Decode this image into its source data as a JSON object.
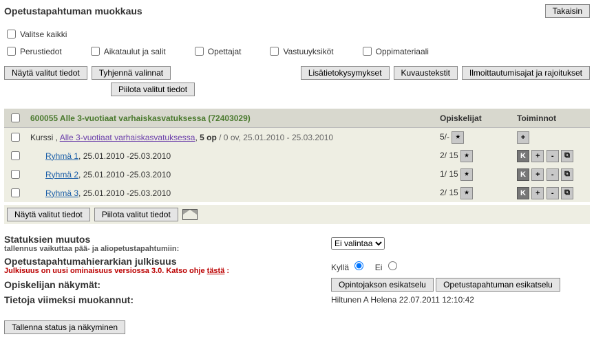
{
  "header": {
    "title": "Opetustapahtuman muokkaus",
    "back": "Takaisin"
  },
  "filters": {
    "select_all": "Valitse kaikki",
    "perustiedot": "Perustiedot",
    "aikataulut": "Aikataulut ja salit",
    "opettajat": "Opettajat",
    "vastuuyksikot": "Vastuuyksiköt",
    "oppimateriaali": "Oppimateriaali"
  },
  "buttons": {
    "nayta": "Näytä valitut tiedot",
    "tyhjenna": "Tyhjennä valinnat",
    "piilota": "Piilota valitut tiedot",
    "lisakysymykset": "Lisätietokysymykset",
    "kuvaustekstit": "Kuvaustekstit",
    "ilmoittautumisajat": "Ilmoittautumisajat ja rajoitukset"
  },
  "table": {
    "head_course": "600055 Alle 3-vuotiaat varhaiskasvatuksessa (72403029)",
    "head_students": "Opiskelijat",
    "head_actions": "Toiminnot",
    "course": {
      "type": "Kurssi",
      "link": "Alle 3-vuotiaat varhaiskasvatuksessa",
      "credits": "5 op",
      "meta": "/ 0 ov, 25.01.2010 - 25.03.2010",
      "students": "5/-"
    },
    "rows": [
      {
        "name": "Ryhmä 1",
        "dates": ", 25.01.2010 -25.03.2010",
        "students": "2/ 15"
      },
      {
        "name": "Ryhmä 2",
        "dates": ", 25.01.2010 -25.03.2010",
        "students": "1/ 15"
      },
      {
        "name": "Ryhmä 3",
        "dates": ", 25.01.2010 -25.03.2010",
        "students": "2/ 15"
      }
    ]
  },
  "bottom": {
    "nayta": "Näytä valitut tiedot",
    "piilota": "Piilota valitut tiedot"
  },
  "status": {
    "title": "Statuksien muutos",
    "note": "tallennus vaikuttaa pää- ja aliopetustapahtumiin:",
    "select": "Ei valintaa"
  },
  "publicity": {
    "title": "Opetustapahtumahierarkian julkisuus",
    "note_prefix": "Julkisuus on uusi ominaisuus versiossa 3.0. Katso ohje ",
    "note_link": "tästä",
    "note_suffix": " :",
    "yes": "Kyllä",
    "no": "Ei"
  },
  "views": {
    "title": "Opiskelijan näkymät:",
    "preview1": "Opintojakson esikatselu",
    "preview2": "Opetustapahtuman esikatselu"
  },
  "modified": {
    "label": "Tietoja viimeksi muokannut:",
    "value": "Hiltunen A Helena 22.07.2011 12:10:42"
  },
  "save": "Tallenna status ja näkyminen"
}
